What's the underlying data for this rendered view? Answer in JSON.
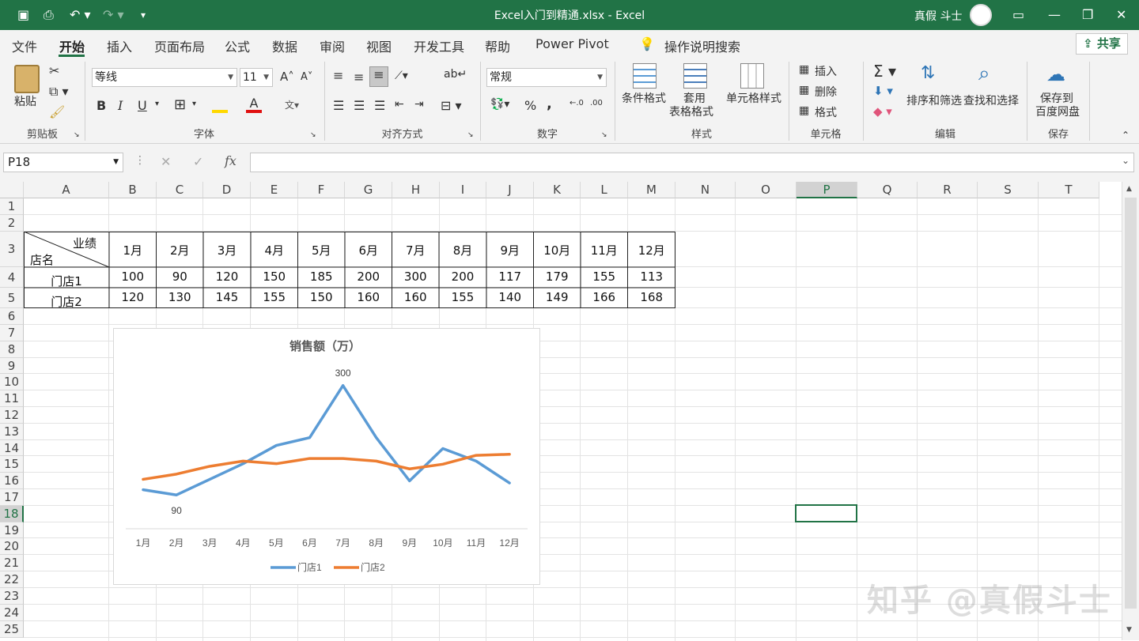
{
  "window": {
    "title": "Excel入门到精通.xlsx  -  Excel",
    "user": "真假 斗士"
  },
  "menu": {
    "items": [
      "文件",
      "开始",
      "插入",
      "页面布局",
      "公式",
      "数据",
      "审阅",
      "视图",
      "开发工具",
      "帮助",
      "Power Pivot"
    ],
    "active": "开始",
    "tell_me": "操作说明搜索",
    "share": "共享"
  },
  "ribbon": {
    "clipboard": {
      "paste": "粘贴",
      "label": "剪贴板"
    },
    "font": {
      "name": "等线",
      "size": "11",
      "bold": "B",
      "italic": "I",
      "underline": "U",
      "label": "字体"
    },
    "alignment": {
      "label": "对齐方式"
    },
    "number": {
      "format": "常规",
      "percent": "%",
      "comma": ",",
      "label": "数字"
    },
    "styles": {
      "conditional": "条件格式",
      "table1": "套用",
      "table2": "表格格式",
      "cell_style": "单元格样式",
      "label": "样式"
    },
    "cells": {
      "insert": "插入",
      "delete": "删除",
      "format": "格式",
      "label": "单元格"
    },
    "editing": {
      "sort": "排序和筛选",
      "find": "查找和选择",
      "label": "编辑"
    },
    "save": {
      "line1": "保存到",
      "line2": "百度网盘",
      "label": "保存"
    }
  },
  "formula_bar": {
    "name_box": "P18",
    "fx": "fx",
    "formula": ""
  },
  "columns": [
    "A",
    "B",
    "C",
    "D",
    "E",
    "F",
    "G",
    "H",
    "I",
    "J",
    "K",
    "L",
    "M",
    "N",
    "O",
    "P",
    "Q",
    "R",
    "S",
    "T"
  ],
  "rows": [
    "1",
    "2",
    "3",
    "4",
    "5",
    "6",
    "7",
    "8",
    "9",
    "10",
    "11",
    "12",
    "13",
    "14",
    "15",
    "16",
    "17",
    "18",
    "19",
    "20",
    "21",
    "22",
    "23",
    "24",
    "25"
  ],
  "table": {
    "corner_top": "业绩",
    "corner_bottom": "店名",
    "months": [
      "1月",
      "2月",
      "3月",
      "4月",
      "5月",
      "6月",
      "7月",
      "8月",
      "9月",
      "10月",
      "11月",
      "12月"
    ],
    "stores": [
      {
        "name": "门店1",
        "values": [
          "100",
          "90",
          "120",
          "150",
          "185",
          "200",
          "300",
          "200",
          "117",
          "179",
          "155",
          "113"
        ]
      },
      {
        "name": "门店2",
        "values": [
          "120",
          "130",
          "145",
          "155",
          "150",
          "160",
          "160",
          "155",
          "140",
          "149",
          "166",
          "168"
        ]
      }
    ]
  },
  "chart_data": {
    "type": "line",
    "title": "销售额（万）",
    "categories": [
      "1月",
      "2月",
      "3月",
      "4月",
      "5月",
      "6月",
      "7月",
      "8月",
      "9月",
      "10月",
      "11月",
      "12月"
    ],
    "series": [
      {
        "name": "门店1",
        "color": "#5b9bd5",
        "values": [
          100,
          90,
          120,
          150,
          185,
          200,
          300,
          200,
          117,
          179,
          155,
          113
        ]
      },
      {
        "name": "门店2",
        "color": "#ed7d31",
        "values": [
          120,
          130,
          145,
          155,
          150,
          160,
          160,
          155,
          140,
          149,
          166,
          168
        ]
      }
    ],
    "data_labels": [
      {
        "series": "门店1",
        "category": "7月",
        "text": "300"
      },
      {
        "series": "门店1",
        "category": "2月",
        "text": "90"
      }
    ],
    "legend": "bottom",
    "grid": false
  },
  "watermark": "知乎 @真假斗士",
  "colors": {
    "accent": "#217346"
  }
}
